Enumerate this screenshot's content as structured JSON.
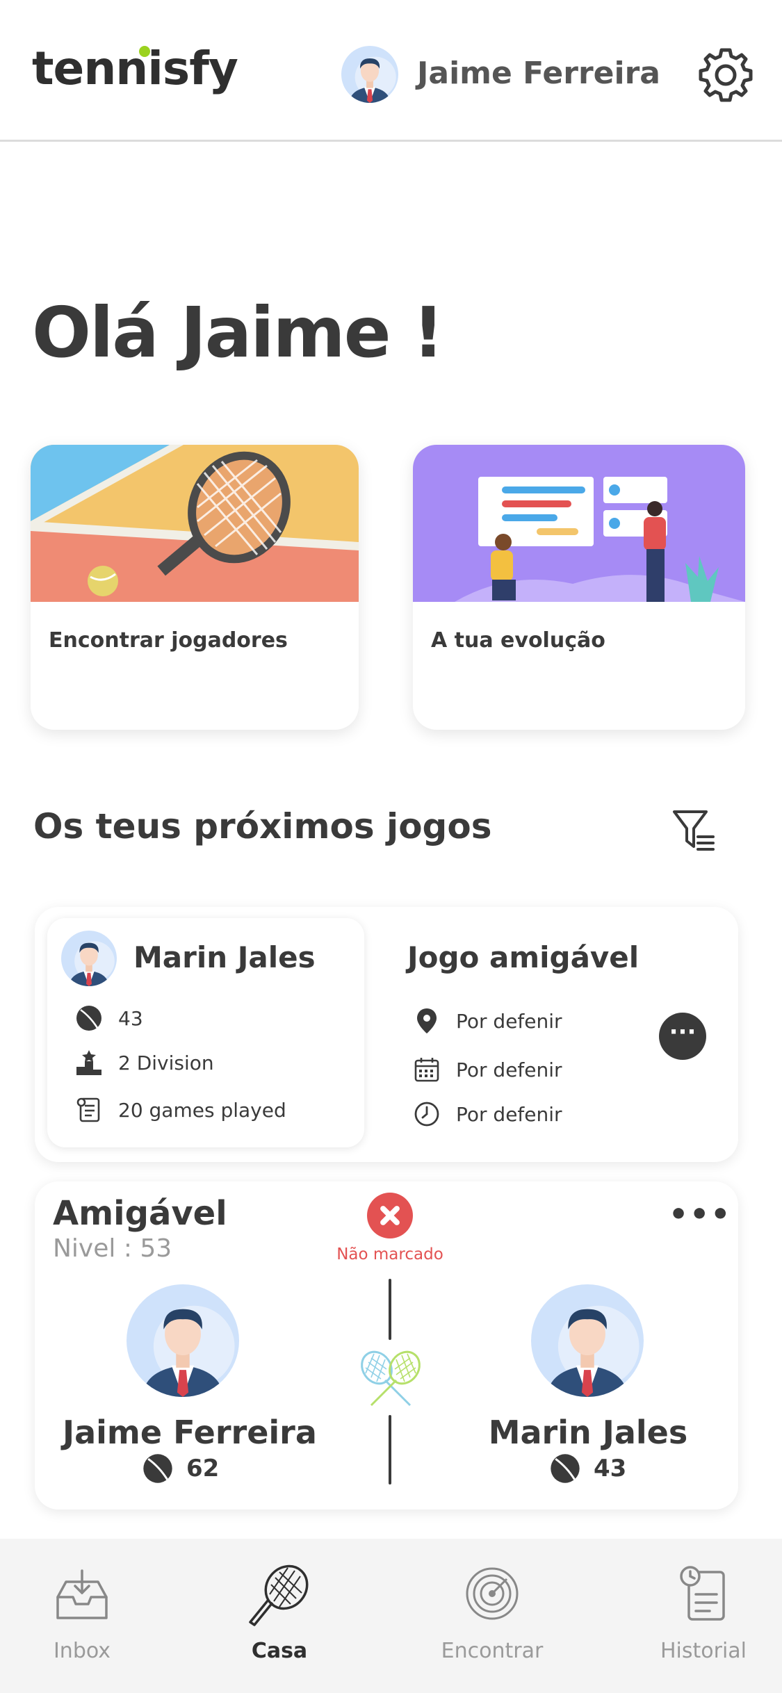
{
  "header": {
    "logo": "tennisfy",
    "user_name": "Jaime Ferreira",
    "settings_icon": "gear-icon",
    "accent": "#9bd21f"
  },
  "greeting": "Olá Jaime !",
  "feature_cards": [
    {
      "label": "Encontrar jogadores",
      "image": "tennis-racket-illustration"
    },
    {
      "label": "A tua evolução",
      "image": "analytics-illustration"
    }
  ],
  "upcoming": {
    "title": "Os teus próximos jogos",
    "filter_icon": "filter-icon"
  },
  "match1": {
    "opponent": "Marin Jales",
    "level": "43",
    "division": "2 Division",
    "games": "20 games played",
    "type": "Jogo amigável",
    "location": "Por defenir",
    "date": "Por defenir",
    "time": "Por defenir",
    "more": "···"
  },
  "match2": {
    "title": "Amigável",
    "level": "Nivel : 53",
    "status": "Não marcado",
    "status_color": "#e35252",
    "more": "•••",
    "player1": {
      "name": "Jaime Ferreira",
      "score": "62"
    },
    "player2": {
      "name": "Marin Jales",
      "score": "43"
    }
  },
  "nav": {
    "items": [
      {
        "label": "Inbox",
        "icon": "inbox-icon"
      },
      {
        "label": "Casa",
        "icon": "racket-icon",
        "active": true
      },
      {
        "label": "Encontrar",
        "icon": "radar-icon"
      },
      {
        "label": "Historial",
        "icon": "history-icon"
      }
    ]
  }
}
